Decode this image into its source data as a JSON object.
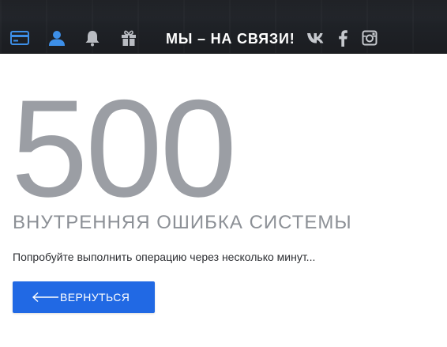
{
  "header": {
    "contact_title": "МЫ – НА СВЯЗИ!",
    "icons": {
      "card": "credit-card-icon",
      "user": "user-icon",
      "bell": "bell-icon",
      "gift": "gift-icon",
      "vk": "vk-icon",
      "facebook": "facebook-icon",
      "instagram": "instagram-icon"
    },
    "colors": {
      "active_icon": "#3d8fe8",
      "inactive_icon": "#b9bcc2",
      "social_icon": "#c5c8cd"
    }
  },
  "error": {
    "code": "500",
    "title": "ВНУТРЕННЯЯ ОШИБКА СИСТЕМЫ",
    "message": "Попробуйте выполнить операцию через несколько минут..."
  },
  "back_button": {
    "label": "ВЕРНУТЬСЯ",
    "icon": "arrow-left-icon",
    "color": "#2169e4"
  }
}
